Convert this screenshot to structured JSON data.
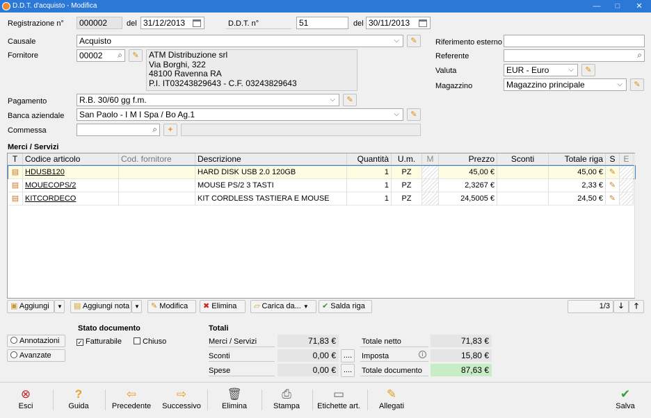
{
  "window": {
    "title": "D.D.T. d'acquisto - Modifica",
    "minimize": "—",
    "maximize": "□",
    "close": "✕"
  },
  "header": {
    "reg_label": "Registrazione n°",
    "reg_value": "000002",
    "del_label": "del",
    "reg_date": "31/12/2013",
    "ddt_label": "D.D.T. n°",
    "ddt_value": "51",
    "del2_label": "del",
    "ddt_date": "30/11/2013"
  },
  "form": {
    "causale_label": "Causale",
    "causale_value": "Acquisto",
    "fornitore_label": "Fornitore",
    "fornitore_code": "00002",
    "fornitore_address": [
      "ATM Distribuzione srl",
      "Via Borghi, 322",
      "48100 Ravenna RA",
      "P.I. IT03243829643 - C.F. 03243829643"
    ],
    "rif_label": "Riferimento esterno",
    "rif_value": "",
    "referente_label": "Referente",
    "referente_value": "",
    "valuta_label": "Valuta",
    "valuta_value": "EUR - Euro",
    "magazzino_label": "Magazzino",
    "magazzino_value": "Magazzino principale",
    "pagamento_label": "Pagamento",
    "pagamento_value": "R.B. 30/60 gg f.m.",
    "banca_label": "Banca aziendale",
    "banca_value": "San Paolo - I M I Spa / Bo Ag.1",
    "commessa_label": "Commessa",
    "commessa_value": ""
  },
  "grid": {
    "section_title": "Merci / Servizi",
    "columns": [
      "T",
      "Codice articolo",
      "Cod. fornitore",
      "Descrizione",
      "Quantità",
      "U.m.",
      "M",
      "Prezzo",
      "Sconti",
      "Totale riga",
      "S",
      "E"
    ],
    "rows": [
      {
        "code": "HDUSB120",
        "cod_forn": "",
        "desc": "HARD DISK USB 2.0 120GB",
        "qty": "1",
        "um": "PZ",
        "price": "45,00 €",
        "sconti": "",
        "total": "45,00 €"
      },
      {
        "code": "MOUECOPS/2",
        "cod_forn": "",
        "desc": "MOUSE PS/2 3 TASTI",
        "qty": "1",
        "um": "PZ",
        "price": "2,3267 €",
        "sconti": "",
        "total": "2,33 €"
      },
      {
        "code": "KITCORDECO",
        "cod_forn": "",
        "desc": "KIT CORDLESS TASTIERA E MOUSE",
        "qty": "1",
        "um": "PZ",
        "price": "24,5005 €",
        "sconti": "",
        "total": "24,50 €"
      }
    ]
  },
  "toolbar": {
    "aggiungi": "Aggiungi",
    "aggiungi_nota": "Aggiungi nota",
    "modifica": "Modifica",
    "elimina": "Elimina",
    "carica_da": "Carica da...",
    "salda_riga": "Salda riga",
    "page": "1/3"
  },
  "stato": {
    "annotazioni": "Annotazioni",
    "avanzate": "Avanzate",
    "title": "Stato documento",
    "fatturabile": "Fatturabile",
    "fatturabile_checked": true,
    "chiuso": "Chiuso",
    "chiuso_checked": false
  },
  "totali": {
    "title": "Totali",
    "merci_label": "Merci / Servizi",
    "merci_value": "71,83 €",
    "sconti_label": "Sconti",
    "sconti_value": "0,00 €",
    "spese_label": "Spese",
    "spese_value": "0,00 €",
    "netto_label": "Totale netto",
    "netto_value": "71,83 €",
    "imposta_label": "Imposta",
    "imposta_value": "15,80 €",
    "documento_label": "Totale documento",
    "documento_value": "87,63 €",
    "ellipsis": "...."
  },
  "bottom": {
    "esci": "Esci",
    "guida": "Guida",
    "precedente": "Precedente",
    "successivo": "Successivo",
    "elimina": "Elimina",
    "stampa": "Stampa",
    "etichette": "Etichette art.",
    "allegati": "Allegati",
    "salva": "Salva"
  },
  "colors": {
    "titlebar": "#2b78d7",
    "selected_row": "#fdfbe0",
    "total_doc": "#c7ecc6"
  }
}
